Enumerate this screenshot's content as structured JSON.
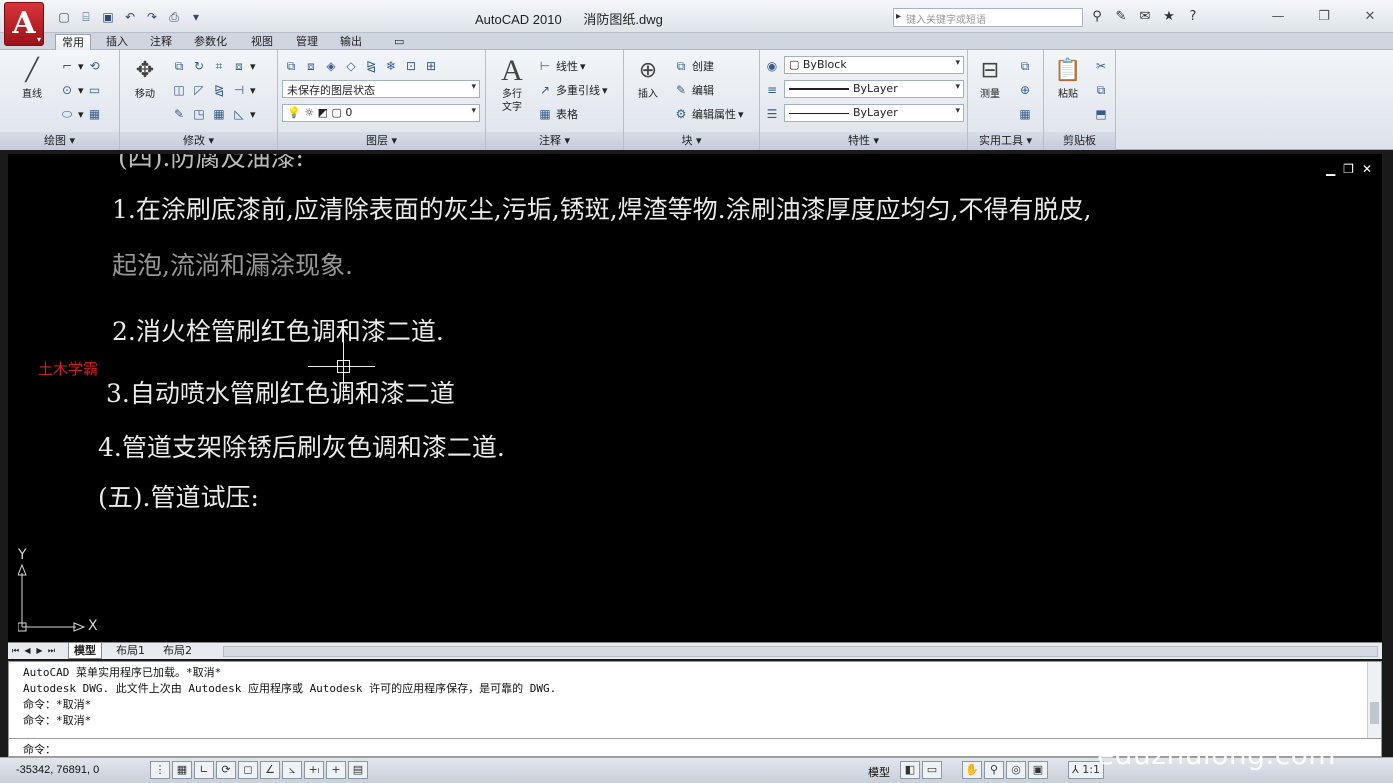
{
  "app": {
    "title": "AutoCAD 2010",
    "file": "消防图纸.dwg",
    "logo_letter": "A",
    "search_placeholder": "键入关键字或短语"
  },
  "qat": [
    "new-icon",
    "open-icon",
    "save-icon",
    "undo-icon",
    "redo-icon",
    "plot-icon"
  ],
  "tabs": [
    "常用",
    "插入",
    "注释",
    "参数化",
    "视图",
    "管理",
    "输出",
    "▭"
  ],
  "ribbon": {
    "draw": {
      "title": "绘图 ▾",
      "line": "直线"
    },
    "modify": {
      "title": "修改 ▾",
      "move": "移动"
    },
    "layers": {
      "title": "图层 ▾",
      "layer_state": "未保存的图层状态",
      "layer_current": "0"
    },
    "annotation": {
      "title": "注释 ▾",
      "mtext_1": "多行",
      "mtext_2": "文字",
      "linear": "线性",
      "mleader": "多重引线",
      "table": "表格"
    },
    "block": {
      "title": "块 ▾",
      "insert": "插入",
      "create": "创建",
      "edit": "编辑",
      "edit_attr": "编辑属性"
    },
    "properties": {
      "title": "特性 ▾",
      "color": "ByBlock",
      "linetype": "ByLayer",
      "lineweight": "ByLayer"
    },
    "utilities": {
      "title": "实用工具 ▾",
      "measure": "测量"
    },
    "clipboard": {
      "title": "剪贴板",
      "paste": "粘贴"
    }
  },
  "drawing": {
    "line_top_partial": "(四).防腐及油漆:",
    "line1": "1.在涂刷底漆前,应清除表面的灰尘,污垢,锈斑,焊渣等物.涂刷油漆厚度应均匀,不得有脱皮,",
    "line2": "起泡,流淌和漏涂现象.",
    "line3": "2.消火栓管刷红色调和漆二道.",
    "line4": "3.自动喷水管刷红色调和漆二道",
    "line5": "4.管道支架除锈后刷灰色调和漆二道.",
    "line6": "(五).管道试压:",
    "watermark": "土木学霸",
    "ucs_x": "X",
    "ucs_y": "Y"
  },
  "layout_tabs": [
    "模型",
    "布局1",
    "布局2"
  ],
  "command": {
    "lines": [
      "AutoCAD 菜单实用程序已加载。*取消*",
      "Autodesk DWG.  此文件上次由 Autodesk 应用程序或 Autodesk 许可的应用程序保存，是可靠的 DWG.",
      "命令：*取消*",
      "命令：*取消*"
    ],
    "prompt": "命令："
  },
  "status": {
    "coords": "-35342, 76891, 0",
    "model": "模型",
    "scale": "1:1"
  },
  "brand": "eduzhulong.com",
  "colors": {
    "ribbon_bg": "#e6ebf1",
    "canvas_bg": "#000000",
    "app_red": "#c41e24"
  }
}
